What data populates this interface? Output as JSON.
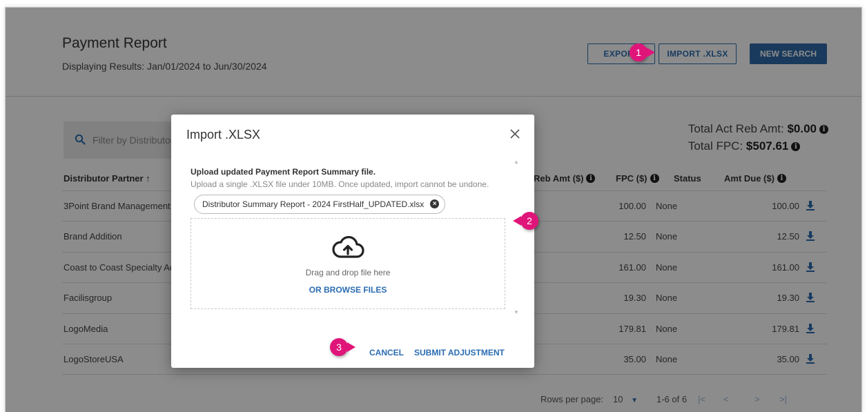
{
  "header": {
    "title": "Payment Report",
    "subtitle": "Displaying Results: Jan/01/2024 to Jun/30/2024",
    "export_label": "EXPORT",
    "import_label": "IMPORT .XLSX",
    "new_search_label": "NEW SEARCH"
  },
  "search": {
    "placeholder": "Filter by Distributor"
  },
  "totals": {
    "act_reb_label": "Total Act Reb Amt:",
    "act_reb_value": "$0.00",
    "fpc_label": "Total FPC:",
    "fpc_value": "$507.61"
  },
  "table": {
    "headers": {
      "distributor": "Distributor Partner ↑",
      "reb_amt": "Reb Amt ($)",
      "fpc": "FPC ($)",
      "status": "Status",
      "amt_due": "Amt Due ($)"
    },
    "rows": [
      {
        "name": "3Point Brand Management",
        "fpc": "100.00",
        "status": "None",
        "amt_due": "100.00"
      },
      {
        "name": "Brand Addition",
        "fpc": "12.50",
        "status": "None",
        "amt_due": "12.50"
      },
      {
        "name": "Coast to Coast Specialty Ad",
        "fpc": "161.00",
        "status": "None",
        "amt_due": "161.00"
      },
      {
        "name": "Facilisgroup",
        "fpc": "19.30",
        "status": "None",
        "amt_due": "19.30"
      },
      {
        "name": "LogoMedia",
        "fpc": "179.81",
        "status": "None",
        "amt_due": "179.81"
      },
      {
        "name": "LogoStoreUSA",
        "fpc": "35.00",
        "status": "None",
        "amt_due": "35.00"
      }
    ]
  },
  "pagination": {
    "rows_per_page_label": "Rows per page:",
    "rows_per_page_value": "10",
    "range": "1-6 of 6"
  },
  "modal": {
    "title": "Import .XLSX",
    "heading": "Upload updated Payment Report Summary file.",
    "description": "Upload a single .XLSX file under 10MB. Once updated, import cannot be undone.",
    "file_name": "Distributor Summary Report - 2024 FirstHalf_UPDATED.xlsx",
    "drag_text": "Drag and drop file here",
    "browse_label": "OR BROWSE FILES",
    "cancel_label": "CANCEL",
    "submit_label": "SUBMIT ADJUSTMENT"
  },
  "annotations": {
    "step1": "1",
    "step2": "2",
    "step3": "3"
  },
  "colors": {
    "accent": "#2b6cb0",
    "primary_button": "#2f6aa8",
    "annotation": "#e0157a"
  }
}
